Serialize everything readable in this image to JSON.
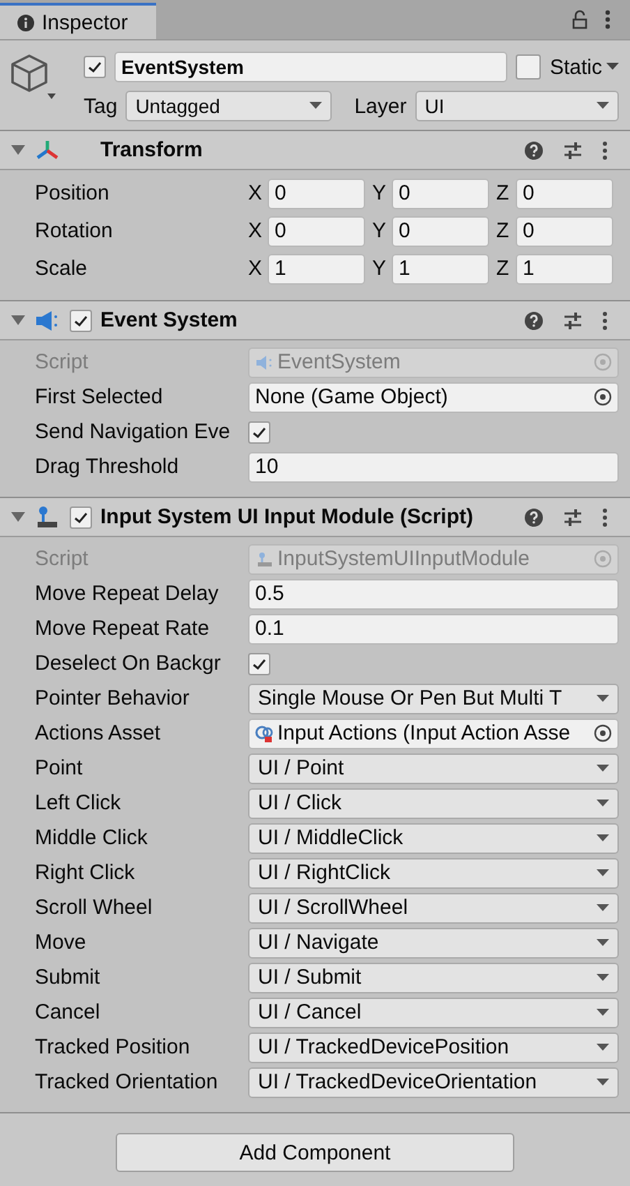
{
  "tab": {
    "label": "Inspector"
  },
  "object": {
    "active": true,
    "name": "EventSystem",
    "static": false,
    "static_label": "Static",
    "tag_label": "Tag",
    "tag": "Untagged",
    "layer_label": "Layer",
    "layer": "UI"
  },
  "components": [
    {
      "kind": "transform",
      "title": "Transform",
      "expanded": true,
      "rows": [
        {
          "kind": "vector3",
          "label": "Position",
          "fields": [
            {
              "axis": "X",
              "value": "0"
            },
            {
              "axis": "Y",
              "value": "0"
            },
            {
              "axis": "Z",
              "value": "0"
            }
          ]
        },
        {
          "kind": "vector3",
          "label": "Rotation",
          "fields": [
            {
              "axis": "X",
              "value": "0"
            },
            {
              "axis": "Y",
              "value": "0"
            },
            {
              "axis": "Z",
              "value": "0"
            }
          ]
        },
        {
          "kind": "vector3",
          "label": "Scale",
          "fields": [
            {
              "axis": "X",
              "value": "1"
            },
            {
              "axis": "Y",
              "value": "1"
            },
            {
              "axis": "Z",
              "value": "1"
            }
          ]
        }
      ]
    },
    {
      "kind": "event-system",
      "title": "Event System",
      "expanded": true,
      "enabled": true,
      "rows": [
        {
          "kind": "script",
          "label": "Script",
          "value": "EventSystem",
          "disabled": true
        },
        {
          "kind": "object",
          "label": "First Selected",
          "value": "None (Game Object)"
        },
        {
          "kind": "checkbox",
          "label": "Send Navigation Eve",
          "checked": true
        },
        {
          "kind": "number",
          "label": "Drag Threshold",
          "value": "10"
        }
      ]
    },
    {
      "kind": "input-module",
      "title": "Input System UI Input Module (Script)",
      "expanded": true,
      "enabled": true,
      "rows": [
        {
          "kind": "script",
          "label": "Script",
          "value": "InputSystemUIInputModule",
          "disabled": true
        },
        {
          "kind": "number",
          "label": "Move Repeat Delay",
          "value": "0.5"
        },
        {
          "kind": "number",
          "label": "Move Repeat Rate",
          "value": "0.1"
        },
        {
          "kind": "checkbox",
          "label": "Deselect On Backgr",
          "checked": true
        },
        {
          "kind": "dropdown",
          "label": "Pointer Behavior",
          "value": "Single Mouse Or Pen But Multi T"
        },
        {
          "kind": "asset",
          "label": "Actions Asset",
          "value": "Input Actions (Input Action Asse"
        },
        {
          "kind": "dropdown",
          "label": "Point",
          "value": "UI / Point"
        },
        {
          "kind": "dropdown",
          "label": "Left Click",
          "value": "UI / Click"
        },
        {
          "kind": "dropdown",
          "label": "Middle Click",
          "value": "UI / MiddleClick"
        },
        {
          "kind": "dropdown",
          "label": "Right Click",
          "value": "UI / RightClick"
        },
        {
          "kind": "dropdown",
          "label": "Scroll Wheel",
          "value": "UI / ScrollWheel"
        },
        {
          "kind": "dropdown",
          "label": "Move",
          "value": "UI / Navigate"
        },
        {
          "kind": "dropdown",
          "label": "Submit",
          "value": "UI / Submit"
        },
        {
          "kind": "dropdown",
          "label": "Cancel",
          "value": "UI / Cancel"
        },
        {
          "kind": "dropdown",
          "label": "Tracked Position",
          "value": "UI / TrackedDevicePosition"
        },
        {
          "kind": "dropdown",
          "label": "Tracked Orientation",
          "value": "UI / TrackedDeviceOrientation"
        }
      ]
    }
  ],
  "add_button": "Add Component"
}
